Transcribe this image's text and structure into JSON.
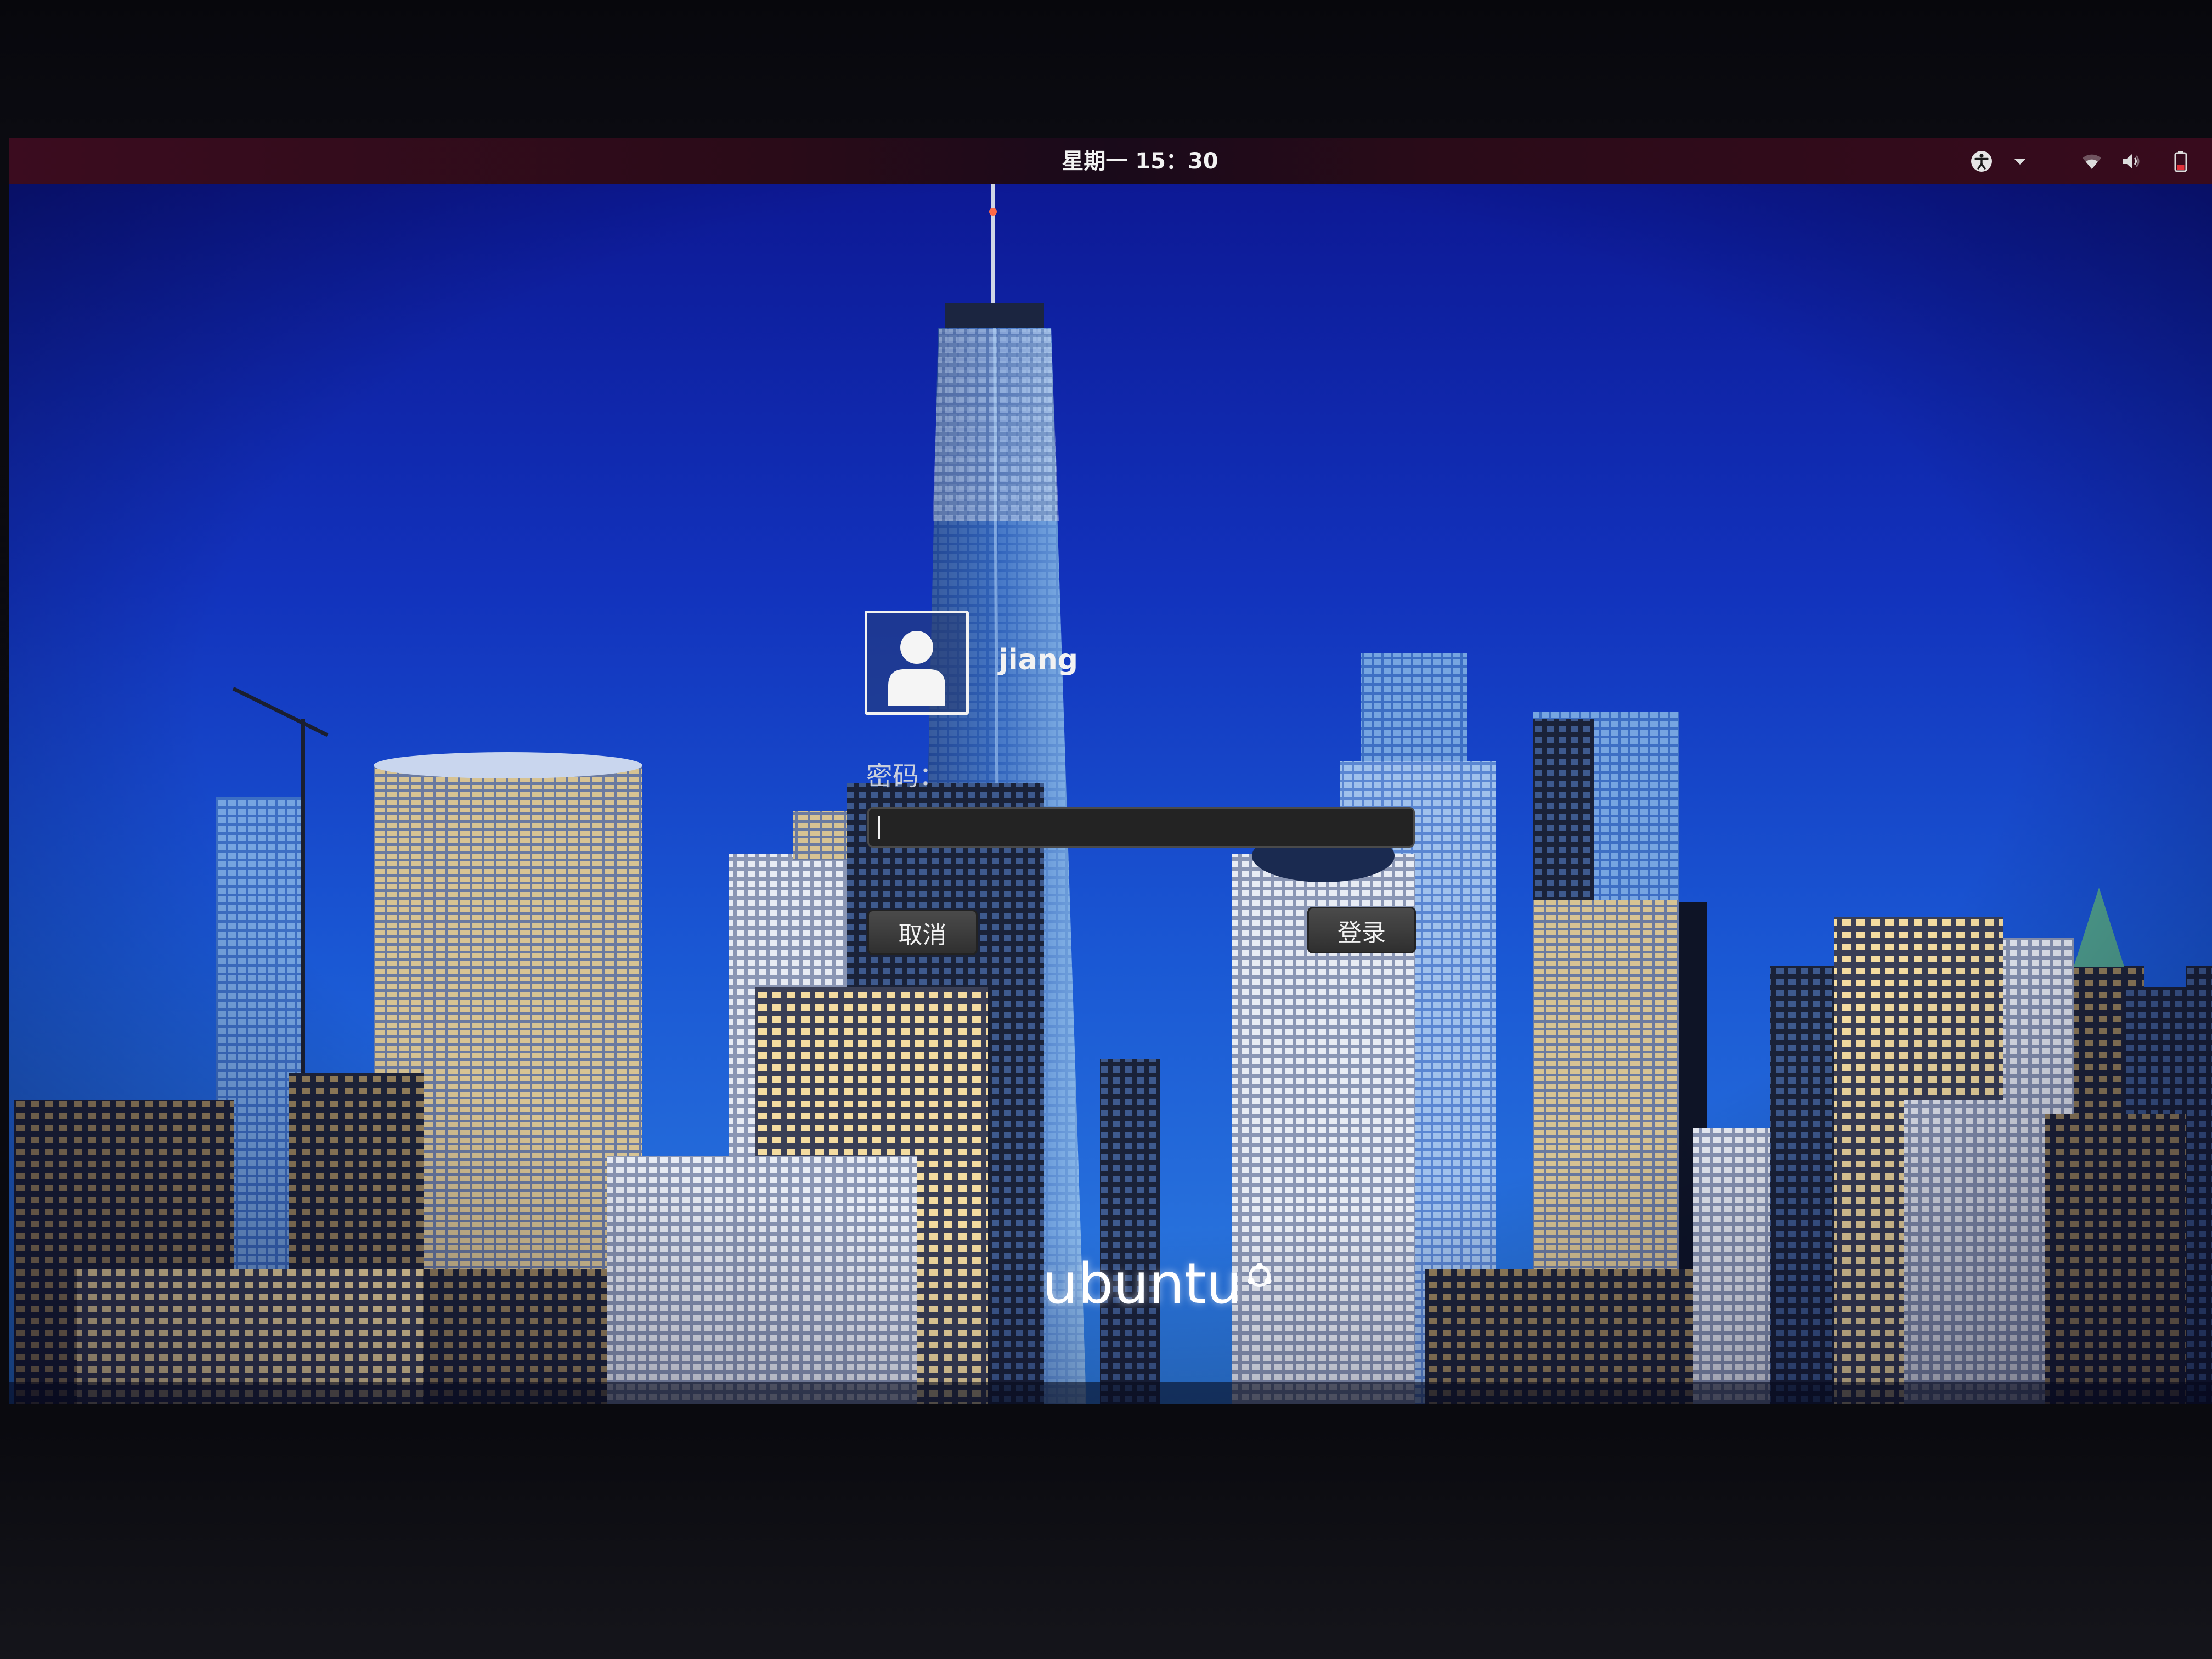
{
  "top_bar": {
    "clock": "星期一 15：30",
    "icons": {
      "accessibility": "accessibility-icon",
      "accessibility_menu": "chevron-down-icon",
      "network": "wifi-icon",
      "sound": "volume-icon",
      "power": "battery-icon"
    }
  },
  "login": {
    "avatar_icon": "user-avatar-icon",
    "user_name": "jiang",
    "password_label": "密码：",
    "password_value": "",
    "cancel_label": "取消",
    "submit_label": "登录"
  },
  "branding": {
    "logo_text": "ubuntu",
    "logo_icon": "circle-of-friends-icon"
  },
  "colors": {
    "top_bar_bg": "#2a0b18",
    "sky_top": "#0c1690",
    "sky_horizon": "#2f7fe0",
    "input_bg": "#232323",
    "button_bg": "#3c3c3c",
    "text_color": "#f2f2f2",
    "label_color": "#c9cfdc",
    "battery_alert": "#e0323a"
  }
}
